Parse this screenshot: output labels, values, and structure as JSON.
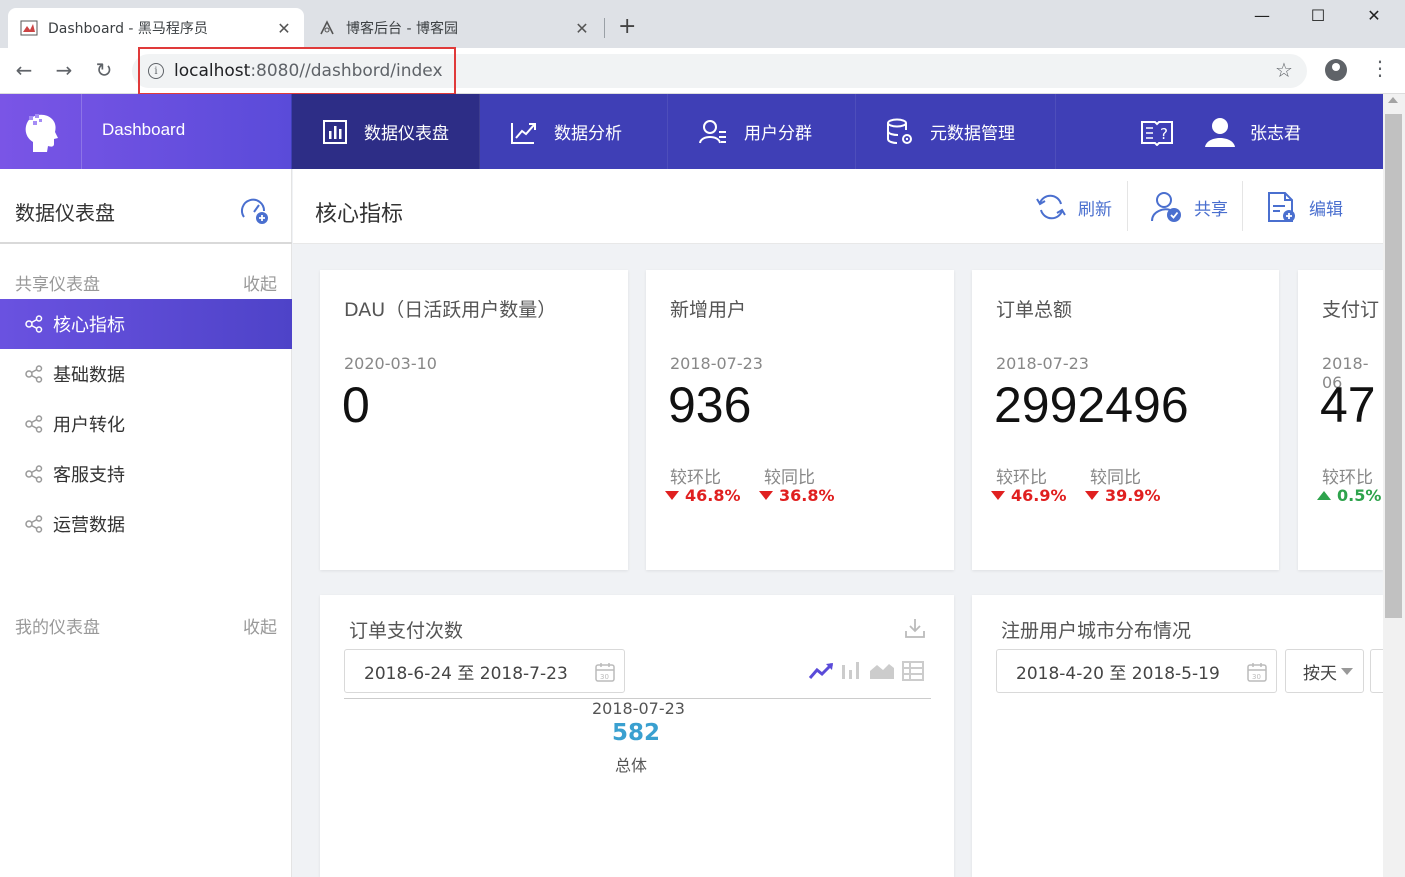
{
  "browser": {
    "tabs": [
      {
        "title": "Dashboard - 黑马程序员"
      },
      {
        "title": "博客后台 - 博客园"
      }
    ],
    "url_host": "localhost",
    "url_path": ":8080//dashbord/index"
  },
  "header": {
    "brand": "Dashboard",
    "nav": [
      {
        "label": "数据仪表盘",
        "icon": "bar-chart-icon"
      },
      {
        "label": "数据分析",
        "icon": "trend-chart-icon"
      },
      {
        "label": "用户分群",
        "icon": "users-icon"
      },
      {
        "label": "元数据管理",
        "icon": "database-gear-icon"
      }
    ],
    "user_name": "张志君"
  },
  "sidebar": {
    "title": "数据仪表盘",
    "shared_section": {
      "label": "共享仪表盘",
      "toggle": "收起"
    },
    "items": [
      {
        "label": "核心指标",
        "active": true
      },
      {
        "label": "基础数据"
      },
      {
        "label": "用户转化"
      },
      {
        "label": "客服支持"
      },
      {
        "label": "运营数据"
      }
    ],
    "my_section": {
      "label": "我的仪表盘",
      "toggle": "收起"
    }
  },
  "content": {
    "title": "核心指标",
    "actions": {
      "refresh": "刷新",
      "share": "共享",
      "edit": "编辑"
    },
    "metrics": [
      {
        "title": "DAU（日活跃用户数量）",
        "date": "2020-03-10",
        "value": "0"
      },
      {
        "title": "新增用户",
        "date": "2018-07-23",
        "value": "936",
        "mom_label": "较环比",
        "mom": "46.8%",
        "mom_dir": "down",
        "yoy_label": "较同比",
        "yoy": "36.8%",
        "yoy_dir": "down"
      },
      {
        "title": "订单总额",
        "date": "2018-07-23",
        "value": "2992496",
        "mom_label": "较环比",
        "mom": "46.9%",
        "mom_dir": "down",
        "yoy_label": "较同比",
        "yoy": "39.9%",
        "yoy_dir": "down"
      },
      {
        "title": "支付订",
        "date": "2018-06",
        "value": "47",
        "mom_label": "较环比",
        "mom": "0.5%",
        "mom_dir": "up"
      }
    ],
    "order_panel": {
      "title": "订单支付次数",
      "date_range": "2018-6-24 至 2018-7-23",
      "tooltip_date": "2018-07-23",
      "tooltip_value": "582",
      "tooltip_label": "总体"
    },
    "city_panel": {
      "title": "注册用户城市分布情况",
      "date_range": "2018-4-20 至 2018-5-19",
      "granularity": "按天"
    }
  },
  "colors": {
    "header_bg": "#3f3fb6",
    "accent": "#5a4bd9",
    "down": "#e02020",
    "up": "#2ea34c",
    "link": "#4a6fcf"
  }
}
